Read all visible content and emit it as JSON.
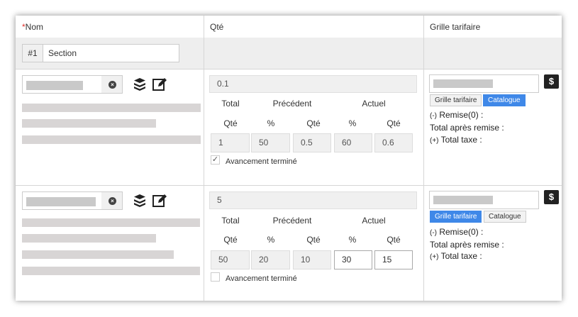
{
  "header": {
    "required_mark": "*",
    "nom": "Nom",
    "qte": "Qté",
    "grille": "Grille tarifaire"
  },
  "section": {
    "number": "#1",
    "value": "Section"
  },
  "table_labels": {
    "total": "Total",
    "precedent": "Précédent",
    "actuel": "Actuel",
    "qte": "Qté",
    "pct": "%"
  },
  "rows": [
    {
      "qty": "0.1",
      "total_qte": "1",
      "prev_pct": "50",
      "prev_qte": "0.5",
      "cur_pct": "60",
      "cur_qte": "0.6",
      "completed_checked": true,
      "completed_label": "Avancement terminé",
      "check_glyph": "✓",
      "pricing_tabs": [
        "Grille tarifaire",
        "Catalogue"
      ],
      "active_tab": "Catalogue",
      "discount_prefix": "(-)",
      "discount_label": "Remise(0) :",
      "total_after": "Total après remise :",
      "tax_prefix": "(+)",
      "tax_label": "Total taxe :"
    },
    {
      "qty": "5",
      "total_qte": "50",
      "prev_pct": "20",
      "prev_qte": "10",
      "cur_pct": "30",
      "cur_qte": "15",
      "completed_checked": false,
      "completed_label": "Avancement terminé",
      "check_glyph": "",
      "pricing_tabs": [
        "Grille tarifaire",
        "Catalogue"
      ],
      "active_tab": "Grille tarifaire",
      "discount_prefix": "(-)",
      "discount_label": "Remise(0) :",
      "total_after": "Total après remise :",
      "tax_prefix": "(+)",
      "tax_label": "Total taxe :"
    }
  ],
  "icons": {
    "clear": "clear-circle-icon",
    "boxes": "boxes-icon",
    "edit": "edit-icon",
    "dollar": "dollar-icon"
  },
  "colors": {
    "accent": "#3f88e8",
    "required": "#e0312b"
  }
}
